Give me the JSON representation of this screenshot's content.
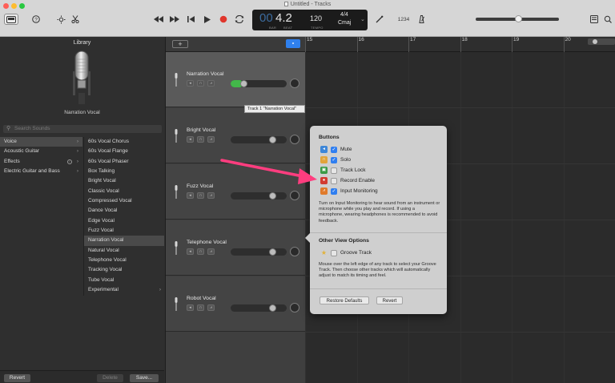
{
  "window": {
    "title": "Untitled - Tracks",
    "traffic_colors": [
      "#ff5f57",
      "#febc2e",
      "#28c840"
    ]
  },
  "toolbar": {
    "icons": [
      "library-icon",
      "help-icon",
      "smart-controls-icon",
      "scissors-icon",
      "rewind-icon",
      "fast-forward-icon",
      "go-to-start-icon",
      "play-icon",
      "record-icon",
      "cycle-icon",
      "tuner-icon",
      "count-in-icon",
      "note-pad-icon",
      "loop-browser-icon"
    ],
    "count_in_label": "1234"
  },
  "lcd": {
    "position_dim": "00",
    "position": "4.2",
    "bar_label": "BAR",
    "beat_label": "BEAT",
    "tempo": "120",
    "tempo_label": "TEMPO",
    "time_sig": "4/4",
    "key": "Cmaj"
  },
  "library": {
    "title": "Library",
    "selected_preset_name": "Narration Vocal",
    "search_placeholder": "Search Sounds",
    "categories": [
      {
        "label": "Voice",
        "selected": true,
        "has_info": false
      },
      {
        "label": "Acoustic Guitar",
        "selected": false,
        "has_info": false
      },
      {
        "label": "Effects",
        "selected": false,
        "has_info": true
      },
      {
        "label": "Electric Guitar and Bass",
        "selected": false,
        "has_info": false
      }
    ],
    "presets": [
      "60s Vocal Chorus",
      "60s Vocal Flange",
      "60s Vocal Phaser",
      "Box Talking",
      "Bright Vocal",
      "Classic Vocal",
      "Compressed Vocal",
      "Dance Vocal",
      "Edge Vocal",
      "Fuzz Vocal",
      "Narration Vocal",
      "Natural Vocal",
      "Telephone Vocal",
      "Tracking Vocal",
      "Tube Vocal",
      "Experimental"
    ],
    "selected_preset_index": 10,
    "footer": {
      "revert": "Revert",
      "delete": "Delete",
      "save": "Save..."
    }
  },
  "tracks_header": {
    "add_label": "+"
  },
  "tracks": [
    {
      "name": "Narration Vocal",
      "selected": true,
      "volume": 0.2
    },
    {
      "name": "Bright Vocal",
      "selected": false,
      "volume": 0.78
    },
    {
      "name": "Fuzz Vocal",
      "selected": false,
      "volume": 0.78
    },
    {
      "name": "Telephone Vocal",
      "selected": false,
      "volume": 0.78
    },
    {
      "name": "Robot Vocal",
      "selected": false,
      "volume": 0.78
    }
  ],
  "tooltip": "Track 1 \"Narration Vocal\"",
  "ruler": {
    "bars": [
      "15",
      "16",
      "17",
      "18",
      "19",
      "20"
    ]
  },
  "popover": {
    "buttons_title": "Buttons",
    "options": [
      {
        "label": "Mute",
        "checked": true,
        "icon": "mute-icon",
        "icon_color": "#3d86d8",
        "glyph": "🔈"
      },
      {
        "label": "Solo",
        "checked": true,
        "icon": "solo-icon",
        "icon_color": "#e2a43a",
        "glyph": "🎧"
      },
      {
        "label": "Track Lock",
        "checked": false,
        "icon": "lock-icon",
        "icon_color": "#3a9a46",
        "glyph": "🔒"
      },
      {
        "label": "Record Enable",
        "checked": false,
        "icon": "record-enable-icon",
        "icon_color": "#d23b30",
        "glyph": "●"
      },
      {
        "label": "Input Monitoring",
        "checked": true,
        "icon": "input-monitoring-icon",
        "icon_color": "#e07a2a",
        "glyph": "⊘"
      }
    ],
    "buttons_desc": "Turn on Input Monitoring to hear sound from an instrument or microphone while you play and record. If using a microphone, wearing headphones is recommended to avoid feedback.",
    "other_title": "Other View Options",
    "groove": {
      "label": "Groove Track",
      "checked": false
    },
    "groove_desc": "Mouse over the left edge of any track to select your Groove Track. Then choose other tracks which will automatically adjust to match its timing and feel.",
    "restore_label": "Restore Defaults",
    "revert_label": "Revert"
  },
  "colors": {
    "accent": "#2f80ed",
    "arrow": "#ff3d7f",
    "volume_active": "#43b84a"
  }
}
